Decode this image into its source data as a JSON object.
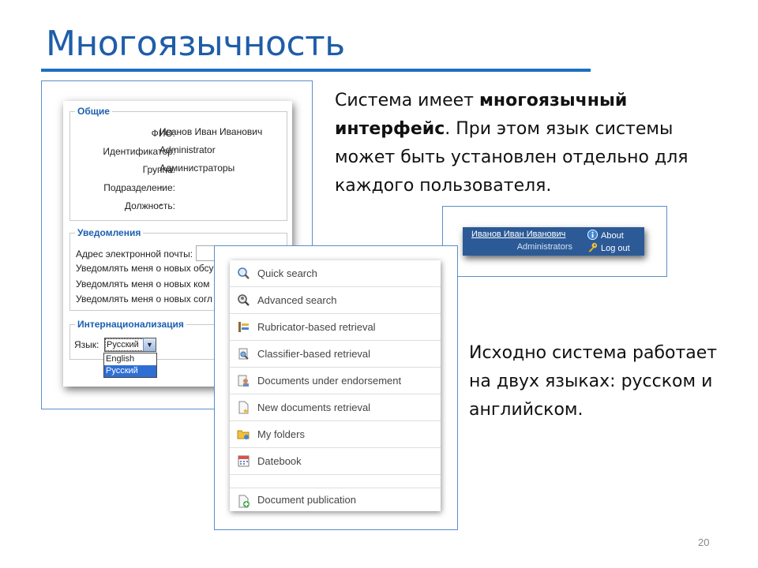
{
  "slide": {
    "title": "Многоязычность",
    "page_number": "20",
    "intro_text": {
      "part1": "Система имеет ",
      "bold1": "многоязычный интерфейс",
      "part2": ". При этом язык системы может быть установлен отдельно для каждого пользователя."
    },
    "second_text": "Исходно система работает на двух языках: русском и английском."
  },
  "profile_form": {
    "general": {
      "legend": "Общие",
      "fields": [
        {
          "label": "ФИО:",
          "value": "Иванов Иван Иванович"
        },
        {
          "label": "Идентификатор:",
          "value": "Administrator"
        },
        {
          "label": "Группа:",
          "value": "Администраторы"
        },
        {
          "label": "Подразделение:",
          "value": "-"
        },
        {
          "label": "Должность:",
          "value": "-"
        }
      ]
    },
    "notifications": {
      "legend": "Уведомления",
      "email_label": "Адрес электронной почты:",
      "lines": [
        "Уведомлять меня о новых обсу",
        "Уведомлять меня о новых ком",
        "Уведомлять меня о новых согл"
      ]
    },
    "i18n": {
      "legend": "Интернационализация",
      "language_label": "Язык:",
      "selected": "Русский",
      "options": [
        "English",
        "Русский"
      ]
    }
  },
  "userbar": {
    "username": "Иванов Иван Иванович",
    "group": "Administrators",
    "about": "About",
    "logout": "Log out"
  },
  "menu": {
    "items": [
      {
        "label": "Quick search",
        "icon": "magnifier-icon"
      },
      {
        "label": "Advanced search",
        "icon": "advanced-search-icon"
      },
      {
        "label": "Rubricator-based retrieval",
        "icon": "rubricator-icon"
      },
      {
        "label": "Classifier-based retrieval",
        "icon": "classifier-icon"
      },
      {
        "label": "Documents under endorsement",
        "icon": "endorsement-icon"
      },
      {
        "label": "New documents retrieval",
        "icon": "new-document-icon"
      },
      {
        "label": "My folders",
        "icon": "folders-icon"
      },
      {
        "label": "Datebook",
        "icon": "calendar-icon"
      },
      {
        "label": "",
        "icon": ""
      },
      {
        "label": "Document publication",
        "icon": "publish-document-icon"
      }
    ]
  },
  "colors": {
    "title": "#1f5da8",
    "rule": "#1d6fc0",
    "userbar_bg": "#2b5a96",
    "legend": "#1b5fb0"
  }
}
